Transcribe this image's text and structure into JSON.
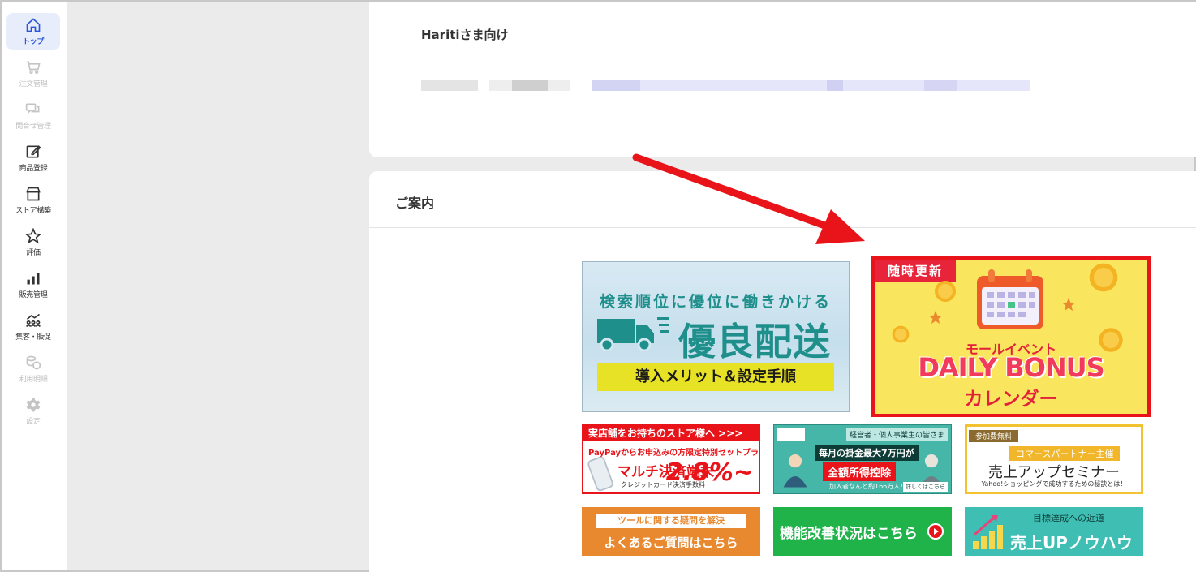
{
  "sidebar": {
    "items": [
      {
        "label": "トップ",
        "icon": "home-icon",
        "state": "active"
      },
      {
        "label": "注文管理",
        "icon": "cart-icon",
        "state": "disabled"
      },
      {
        "label": "問合せ管理",
        "icon": "chat-icon",
        "state": "disabled"
      },
      {
        "label": "商品登録",
        "icon": "edit-icon",
        "state": "normal"
      },
      {
        "label": "ストア構築",
        "icon": "store-icon",
        "state": "normal"
      },
      {
        "label": "評価",
        "icon": "star-icon",
        "state": "normal"
      },
      {
        "label": "販売管理",
        "icon": "bar-chart-icon",
        "state": "normal"
      },
      {
        "label": "集客・販促",
        "icon": "people-chart-icon",
        "state": "normal"
      },
      {
        "label": "利用明細",
        "icon": "coins-icon",
        "state": "disabled"
      },
      {
        "label": "設定",
        "icon": "gear-icon",
        "state": "disabled"
      }
    ]
  },
  "store": {
    "title": "Haritiさま向け"
  },
  "guide": {
    "title": "ご案内",
    "banners": {
      "yuryo": {
        "sub": "検索順位に優位に働きかける",
        "main": "優良配送",
        "button": "導入メリット＆設定手順"
      },
      "daily": {
        "tag": "随時更新",
        "line1": "モールイベント",
        "line2": "DAILY BONUS",
        "line3": "カレンダー"
      },
      "paypay": {
        "head": "実店舗をお持ちのストア様へ >>>",
        "line2": "PayPayからお申込みの方限定特別セットプラン",
        "line3": "マルチ決済端末",
        "line4": "クレジットカード決済手数料",
        "rate": "2.8%~"
      },
      "tax": {
        "top": "経営者・個人事業主の皆さま",
        "line2": "毎月の掛金最大7万円が",
        "line3": "全額所得控除",
        "line4": "加入者なんと約166万人！",
        "button": "詳しくはこちら"
      },
      "seminar": {
        "tag": "参加費無料",
        "line2": "コマースパートナー主催",
        "line3": "売上アップセミナー",
        "line4": "Yahoo!ショッピングで成功するための秘訣とは！"
      },
      "faq": {
        "tag": "ツールに関する疑問を解決",
        "line2": "よくあるご質問はこちら"
      },
      "kaizen": {
        "label": "機能改善状況はこちら"
      },
      "knowhow": {
        "line1": "目標達成への近道",
        "line2": "売上UPノウハウ"
      }
    }
  },
  "colors": {
    "accent": "#2a56d6",
    "arrow": "#e8141a",
    "highlight_border": "#e8141a"
  }
}
